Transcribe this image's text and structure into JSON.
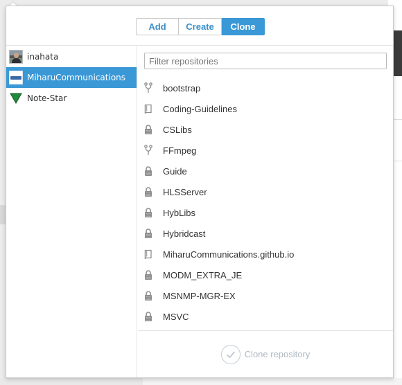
{
  "tabs": [
    {
      "label": "Add",
      "active": false
    },
    {
      "label": "Create",
      "active": false
    },
    {
      "label": "Clone",
      "active": true
    }
  ],
  "accounts": [
    {
      "label": "inahata",
      "icon": "user-avatar-icon",
      "selected": false
    },
    {
      "label": "MiharuCommunications",
      "icon": "org-logo-icon",
      "selected": true
    },
    {
      "label": "Note-Star",
      "icon": "green-triangle-icon",
      "selected": false
    }
  ],
  "filter": {
    "placeholder": "Filter repositories",
    "value": ""
  },
  "repositories": [
    {
      "name": "bootstrap",
      "icon": "fork-icon"
    },
    {
      "name": "Coding-Guidelines",
      "icon": "repo-book-icon"
    },
    {
      "name": "CSLibs",
      "icon": "lock-icon"
    },
    {
      "name": "FFmpeg",
      "icon": "fork-icon"
    },
    {
      "name": "Guide",
      "icon": "lock-icon"
    },
    {
      "name": "HLSServer",
      "icon": "lock-icon"
    },
    {
      "name": "HybLibs",
      "icon": "lock-icon"
    },
    {
      "name": "Hybridcast",
      "icon": "lock-icon"
    },
    {
      "name": "MiharuCommunications.github.io",
      "icon": "repo-book-icon"
    },
    {
      "name": "MODM_EXTRA_JE",
      "icon": "lock-icon"
    },
    {
      "name": "MSNMP-MGR-EX",
      "icon": "lock-icon"
    },
    {
      "name": "MSVC",
      "icon": "lock-icon"
    }
  ],
  "clone_button": {
    "label": "Clone repository",
    "enabled": false
  },
  "colors": {
    "accent": "#3b98d6",
    "icon_gray": "#8e8e8e",
    "disabled": "#b0b8c2"
  }
}
